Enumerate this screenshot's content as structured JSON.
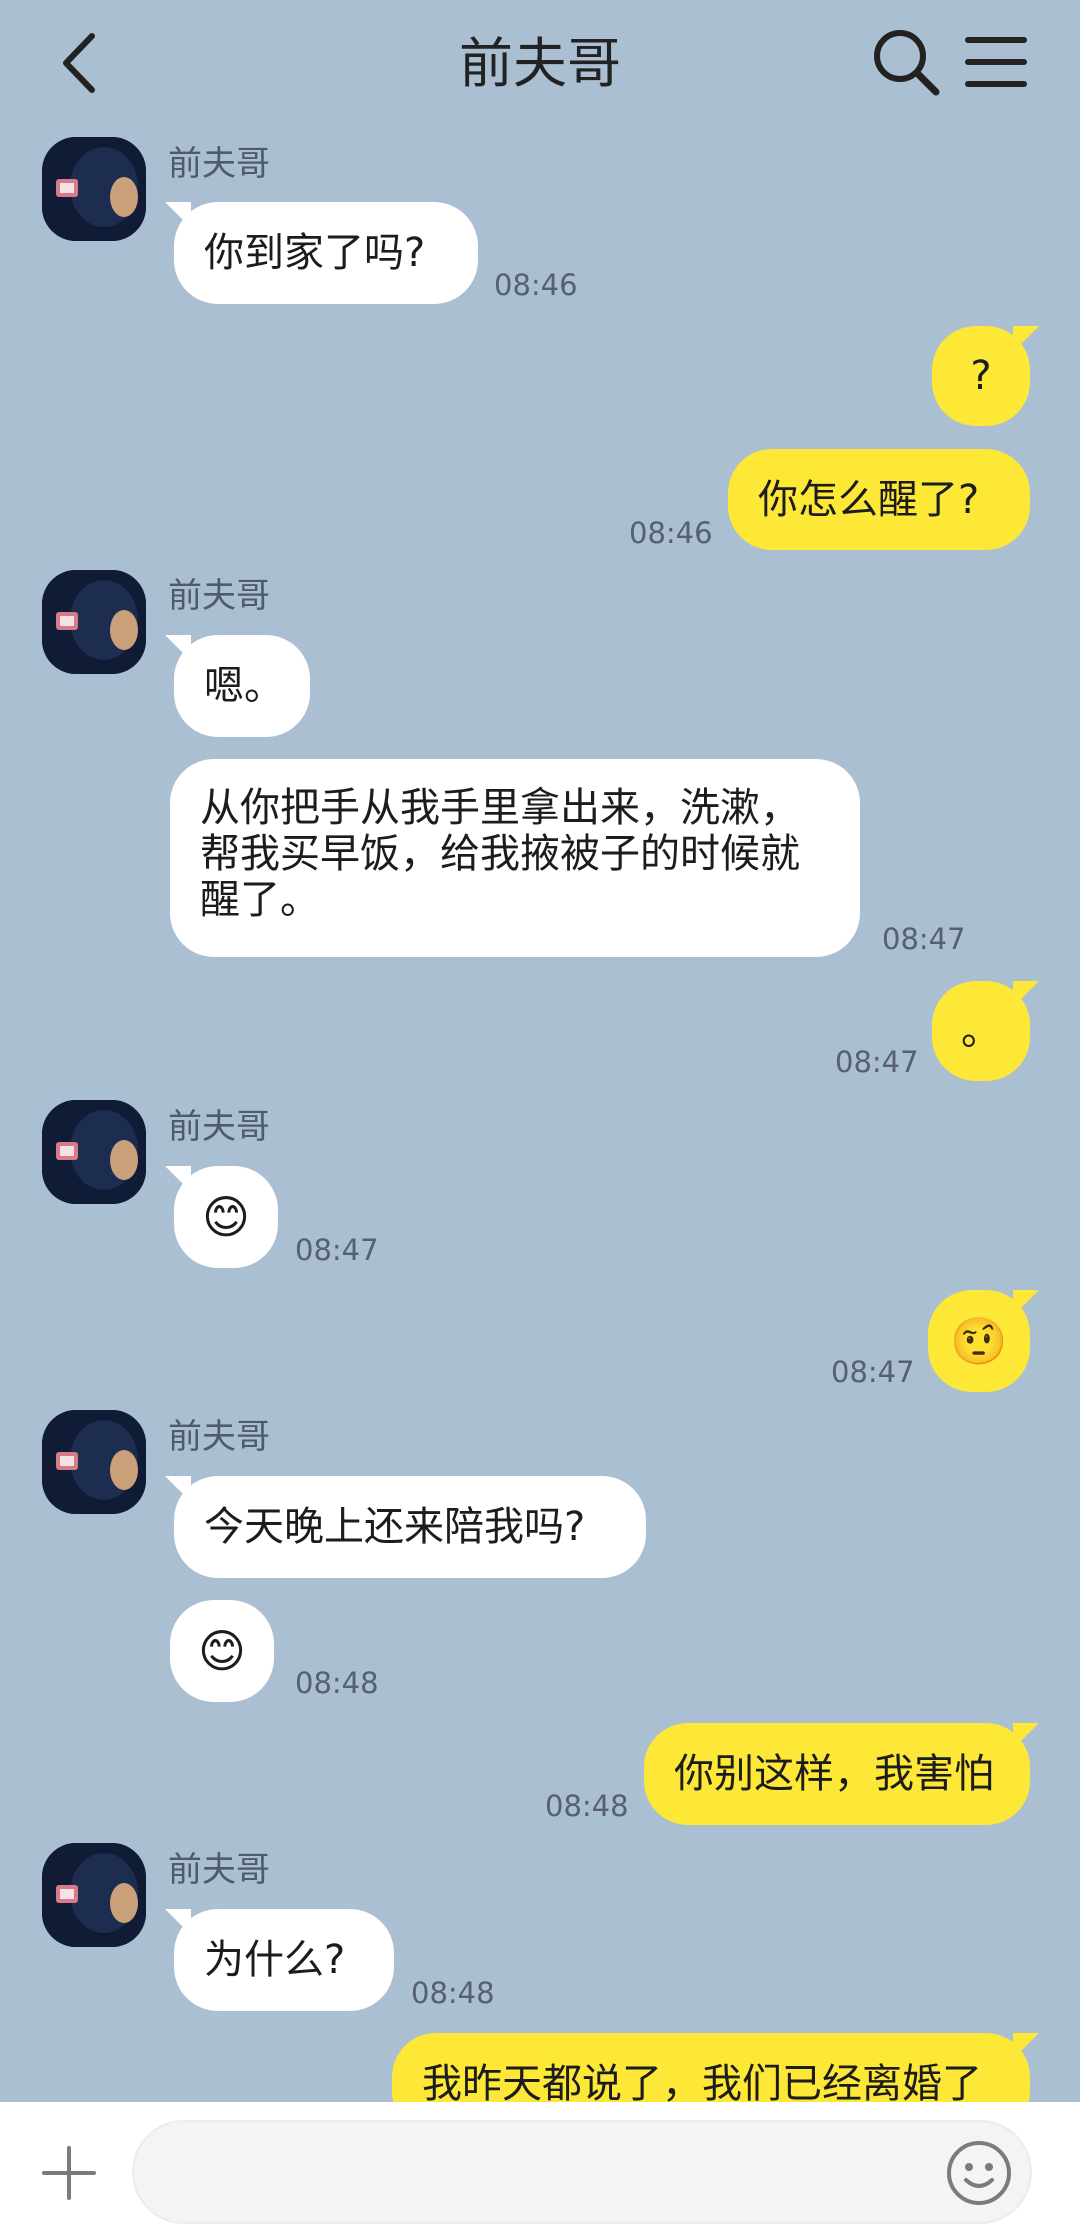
{
  "header": {
    "title": "前夫哥"
  },
  "contact": {
    "name": "前夫哥"
  },
  "messages": [
    {
      "text": "你到家了吗?",
      "time": "08:46"
    },
    {
      "text": "?"
    },
    {
      "text": "你怎么醒了?",
      "time": "08:46"
    },
    {
      "text": "嗯。"
    },
    {
      "text": "从你把手从我手里拿出来，洗漱，帮我买早饭，给我掖被子的时候就醒了。",
      "time": "08:47"
    },
    {
      "text": "。",
      "time": "08:47"
    },
    {
      "text": "😊",
      "time": "08:47"
    },
    {
      "text": "🤨",
      "time": "08:47"
    },
    {
      "text": "今天晚上还来陪我吗?"
    },
    {
      "text": "😊",
      "time": "08:48"
    },
    {
      "text": "你别这样，我害怕",
      "time": "08:48"
    },
    {
      "text": "为什么?",
      "time": "08:48"
    },
    {
      "text": "我昨天都说了，我们已经离婚了"
    }
  ],
  "icons": {
    "back": "chevron-left-icon",
    "search": "search-icon",
    "menu": "hamburger-menu-icon",
    "plus": "plus-icon",
    "emoji": "smiley-face-icon"
  },
  "colors": {
    "background": "#abbfd3",
    "incoming_bubble": "#ffffff",
    "outgoing_bubble": "#fde837"
  }
}
